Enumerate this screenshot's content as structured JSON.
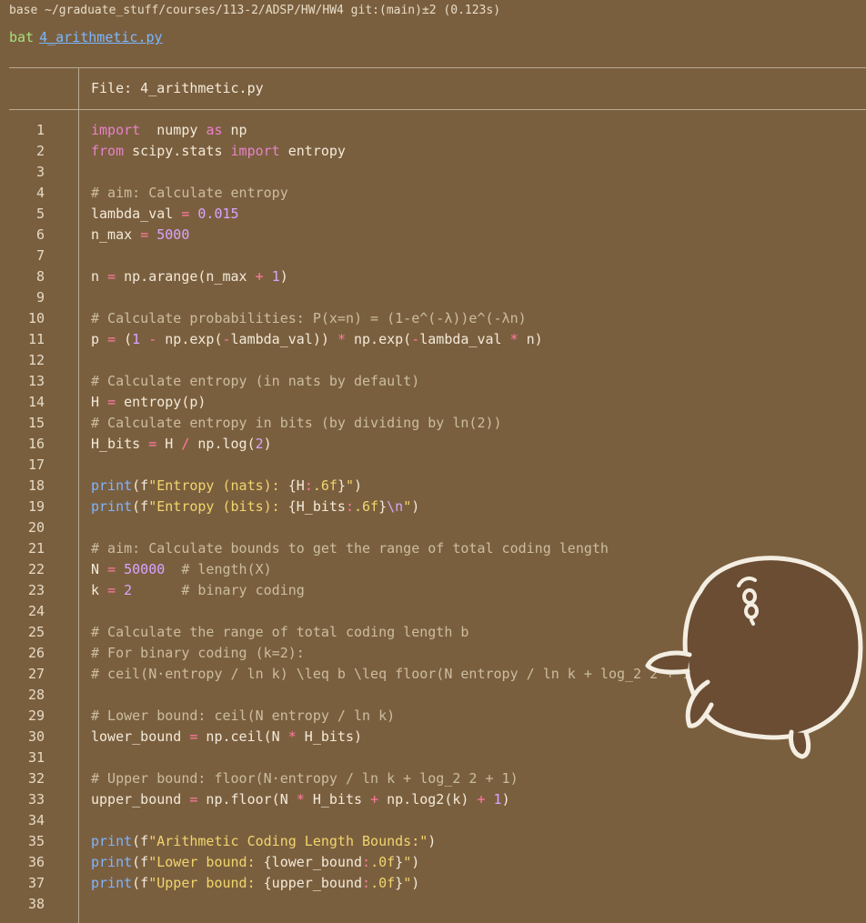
{
  "terminal": {
    "prompt": "base ~/graduate_stuff/courses/113-2/ADSP/HW/HW4 git:(main)±2 (0.123s)",
    "command": "bat",
    "filename": "4_arithmetic.py",
    "file_header": "File: 4_arithmetic.py"
  },
  "colors": {
    "background": "#7a5f3f",
    "keyword": "#e782c7",
    "function": "#7fb4ff",
    "string": "#f1d56d",
    "number": "#d6a5ff",
    "comment": "#cbbd9f",
    "operator": "#ff7aa0"
  },
  "code_lines": [
    {
      "n": "1",
      "t": [
        [
          "kw",
          "import"
        ],
        [
          "",
          "  numpy "
        ],
        [
          "kw",
          "as"
        ],
        [
          "",
          " np"
        ]
      ]
    },
    {
      "n": "2",
      "t": [
        [
          "kw",
          "from"
        ],
        [
          "",
          " scipy.stats "
        ],
        [
          "kw",
          "import"
        ],
        [
          "",
          " entropy"
        ]
      ]
    },
    {
      "n": "3",
      "t": []
    },
    {
      "n": "4",
      "t": [
        [
          "cm",
          "# aim: Calculate entropy"
        ]
      ]
    },
    {
      "n": "5",
      "t": [
        [
          "",
          "lambda_val "
        ],
        [
          "op",
          "="
        ],
        [
          "",
          " "
        ],
        [
          "nm",
          "0.015"
        ]
      ]
    },
    {
      "n": "6",
      "t": [
        [
          "",
          "n_max "
        ],
        [
          "op",
          "="
        ],
        [
          "",
          " "
        ],
        [
          "nm",
          "5000"
        ]
      ]
    },
    {
      "n": "7",
      "t": []
    },
    {
      "n": "8",
      "t": [
        [
          "",
          "n "
        ],
        [
          "op",
          "="
        ],
        [
          "",
          " np.arange(n_max "
        ],
        [
          "op",
          "+"
        ],
        [
          "",
          " "
        ],
        [
          "nm",
          "1"
        ],
        [
          "",
          ")"
        ]
      ]
    },
    {
      "n": "9",
      "t": []
    },
    {
      "n": "10",
      "t": [
        [
          "cm",
          "# Calculate probabilities: P(x=n) = (1-e^(-λ))e^(-λn)"
        ]
      ]
    },
    {
      "n": "11",
      "t": [
        [
          "",
          "p "
        ],
        [
          "op",
          "="
        ],
        [
          "",
          " ("
        ],
        [
          "nm",
          "1"
        ],
        [
          "",
          " "
        ],
        [
          "op",
          "-"
        ],
        [
          "",
          " np.exp("
        ],
        [
          "op",
          "-"
        ],
        [
          "",
          "lambda_val)) "
        ],
        [
          "op",
          "*"
        ],
        [
          "",
          " np.exp("
        ],
        [
          "op",
          "-"
        ],
        [
          "",
          "lambda_val "
        ],
        [
          "op",
          "*"
        ],
        [
          "",
          " n)"
        ]
      ]
    },
    {
      "n": "12",
      "t": []
    },
    {
      "n": "13",
      "t": [
        [
          "cm",
          "# Calculate entropy (in nats by default)"
        ]
      ]
    },
    {
      "n": "14",
      "t": [
        [
          "",
          "H "
        ],
        [
          "op",
          "="
        ],
        [
          "",
          " entropy(p)"
        ]
      ]
    },
    {
      "n": "15",
      "t": [
        [
          "cm",
          "# Calculate entropy in bits (by dividing by ln(2))"
        ]
      ]
    },
    {
      "n": "16",
      "t": [
        [
          "",
          "H_bits "
        ],
        [
          "op",
          "="
        ],
        [
          "",
          " H "
        ],
        [
          "op",
          "/"
        ],
        [
          "",
          " np.log("
        ],
        [
          "nm",
          "2"
        ],
        [
          "",
          ")"
        ]
      ]
    },
    {
      "n": "17",
      "t": []
    },
    {
      "n": "18",
      "t": [
        [
          "fn",
          "print"
        ],
        [
          "",
          "(f"
        ],
        [
          "st",
          "\"Entropy (nats): "
        ],
        [
          "",
          "{H"
        ],
        [
          "op",
          ":"
        ],
        [
          "st",
          ".6f"
        ],
        [
          "",
          "}"
        ],
        [
          "st",
          "\""
        ],
        [
          "",
          ")"
        ]
      ]
    },
    {
      "n": "19",
      "t": [
        [
          "fn",
          "print"
        ],
        [
          "",
          "(f"
        ],
        [
          "st",
          "\"Entropy (bits): "
        ],
        [
          "",
          "{H_bits"
        ],
        [
          "op",
          ":"
        ],
        [
          "st",
          ".6f"
        ],
        [
          "",
          "}"
        ],
        [
          "esc",
          "\\n"
        ],
        [
          "st",
          "\""
        ],
        [
          "",
          ")"
        ]
      ]
    },
    {
      "n": "20",
      "t": []
    },
    {
      "n": "21",
      "t": [
        [
          "cm",
          "# aim: Calculate bounds to get the range of total coding length"
        ]
      ]
    },
    {
      "n": "22",
      "t": [
        [
          "",
          "N "
        ],
        [
          "op",
          "="
        ],
        [
          "",
          " "
        ],
        [
          "nm",
          "50000"
        ],
        [
          "",
          "  "
        ],
        [
          "cm",
          "# length(X)"
        ]
      ]
    },
    {
      "n": "23",
      "t": [
        [
          "",
          "k "
        ],
        [
          "op",
          "="
        ],
        [
          "",
          " "
        ],
        [
          "nm",
          "2"
        ],
        [
          "",
          "      "
        ],
        [
          "cm",
          "# binary coding"
        ]
      ]
    },
    {
      "n": "24",
      "t": []
    },
    {
      "n": "25",
      "t": [
        [
          "cm",
          "# Calculate the range of total coding length b"
        ]
      ]
    },
    {
      "n": "26",
      "t": [
        [
          "cm",
          "# For binary coding (k=2):"
        ]
      ]
    },
    {
      "n": "27",
      "t": [
        [
          "cm",
          "# ceil(N·entropy / ln k) \\leq b \\leq floor(N entropy / ln k + log_2 2 + 1)"
        ]
      ]
    },
    {
      "n": "28",
      "t": []
    },
    {
      "n": "29",
      "t": [
        [
          "cm",
          "# Lower bound: ceil(N entropy / ln k)"
        ]
      ]
    },
    {
      "n": "30",
      "t": [
        [
          "",
          "lower_bound "
        ],
        [
          "op",
          "="
        ],
        [
          "",
          " np.ceil(N "
        ],
        [
          "op",
          "*"
        ],
        [
          "",
          " H_bits)"
        ]
      ]
    },
    {
      "n": "31",
      "t": []
    },
    {
      "n": "32",
      "t": [
        [
          "cm",
          "# Upper bound: floor(N·entropy / ln k + log_2 2 + 1)"
        ]
      ]
    },
    {
      "n": "33",
      "t": [
        [
          "",
          "upper_bound "
        ],
        [
          "op",
          "="
        ],
        [
          "",
          " np.floor(N "
        ],
        [
          "op",
          "*"
        ],
        [
          "",
          " H_bits "
        ],
        [
          "op",
          "+"
        ],
        [
          "",
          " np.log2(k) "
        ],
        [
          "op",
          "+"
        ],
        [
          "",
          " "
        ],
        [
          "nm",
          "1"
        ],
        [
          "",
          ")"
        ]
      ]
    },
    {
      "n": "34",
      "t": []
    },
    {
      "n": "35",
      "t": [
        [
          "fn",
          "print"
        ],
        [
          "",
          "(f"
        ],
        [
          "st",
          "\"Arithmetic Coding Length Bounds:\""
        ],
        [
          "",
          ")"
        ]
      ]
    },
    {
      "n": "36",
      "t": [
        [
          "fn",
          "print"
        ],
        [
          "",
          "(f"
        ],
        [
          "st",
          "\"Lower bound: "
        ],
        [
          "",
          "{lower_bound"
        ],
        [
          "op",
          ":"
        ],
        [
          "st",
          ".0f"
        ],
        [
          "",
          "}"
        ],
        [
          "st",
          "\""
        ],
        [
          "",
          ")"
        ]
      ]
    },
    {
      "n": "37",
      "t": [
        [
          "fn",
          "print"
        ],
        [
          "",
          "(f"
        ],
        [
          "st",
          "\"Upper bound: "
        ],
        [
          "",
          "{upper_bound"
        ],
        [
          "op",
          ":"
        ],
        [
          "st",
          ".0f"
        ],
        [
          "",
          "}"
        ],
        [
          "st",
          "\""
        ],
        [
          "",
          ")"
        ]
      ]
    },
    {
      "n": "38",
      "t": []
    }
  ]
}
